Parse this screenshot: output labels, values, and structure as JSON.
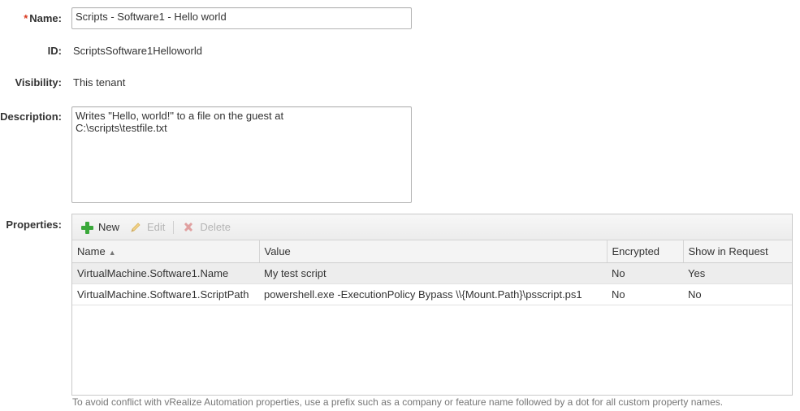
{
  "form": {
    "name_label": "Name:",
    "required_marker": "*",
    "name_value": "Scripts - Software1 - Hello world",
    "id_label": "ID:",
    "id_value": "ScriptsSoftware1Helloworld",
    "visibility_label": "Visibility:",
    "visibility_value": "This tenant",
    "description_label": "Description:",
    "description_value": "Writes \"Hello, world!\" to a file on the guest at\nC:\\scripts\\testfile.txt",
    "properties_label": "Properties:"
  },
  "toolbar": {
    "new_label": "New",
    "edit_label": "Edit",
    "delete_label": "Delete"
  },
  "grid": {
    "columns": [
      "Name",
      "Value",
      "Encrypted",
      "Show in Request"
    ],
    "sort": "ascending",
    "rows": [
      [
        "VirtualMachine.Software1.Name",
        "My test script",
        "No",
        "Yes"
      ],
      [
        "VirtualMachine.Software1.ScriptPath",
        "powershell.exe -ExecutionPolicy Bypass \\\\{Mount.Path}\\psscript.ps1",
        "No",
        "No"
      ]
    ]
  },
  "hint": "To avoid conflict with vRealize Automation properties, use a prefix such as a company or feature name followed by a dot for all custom property names.",
  "colors": {
    "required": "#d9381e",
    "add_icon": "#3aa83a",
    "delete_icon": "#e0a0a0"
  }
}
